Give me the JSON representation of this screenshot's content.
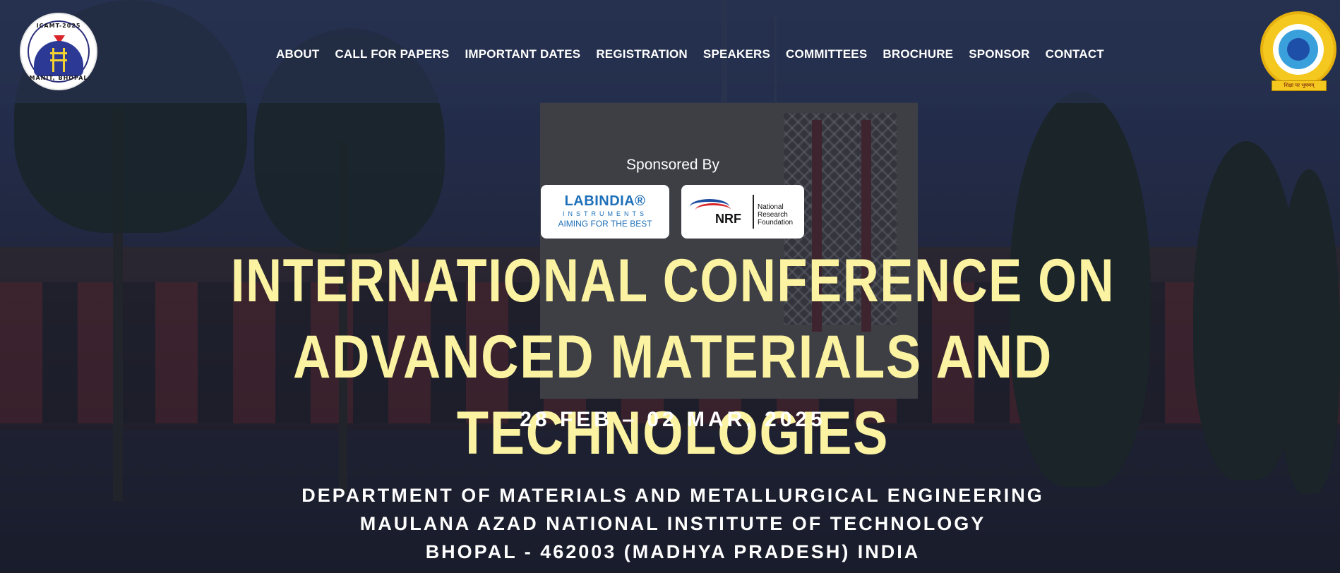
{
  "logos": {
    "left": {
      "top_text": "ICAMT-2025",
      "bottom_text": "MANIT, BHOPAL"
    },
    "right": {
      "ribbon_text": "शिक्षा पर भूषणम्"
    }
  },
  "nav": {
    "items": [
      {
        "label": "ABOUT"
      },
      {
        "label": "CALL FOR PAPERS"
      },
      {
        "label": "IMPORTANT DATES"
      },
      {
        "label": "REGISTRATION"
      },
      {
        "label": "SPEAKERS"
      },
      {
        "label": "COMMITTEES"
      },
      {
        "label": "BROCHURE"
      },
      {
        "label": "SPONSOR"
      },
      {
        "label": "CONTACT"
      }
    ]
  },
  "sponsors": {
    "heading": "Sponsored By",
    "labindia": {
      "name": "LABINDIA®",
      "sub": "INSTRUMENTS",
      "tagline": "AIMING FOR THE BEST"
    },
    "nrf": {
      "letters": "NRF",
      "line1": "National",
      "line2": "Research",
      "line3": "Foundation"
    }
  },
  "hero": {
    "title_line1": "INTERNATIONAL CONFERENCE ON",
    "title_line2": "ADVANCED MATERIALS AND TECHNOLOGIES",
    "dates": "28 FEB – 02 MAR, 2025",
    "dept_line1": "DEPARTMENT OF MATERIALS AND METALLURGICAL ENGINEERING",
    "dept_line2": "MAULANA AZAD NATIONAL INSTITUTE OF TECHNOLOGY",
    "dept_line3": "BHOPAL - 462003 (MADHYA PRADESH) INDIA"
  },
  "colors": {
    "title": "#fbf3a2",
    "nav_text": "#ffffff",
    "labindia_blue": "#1d6fb8"
  }
}
